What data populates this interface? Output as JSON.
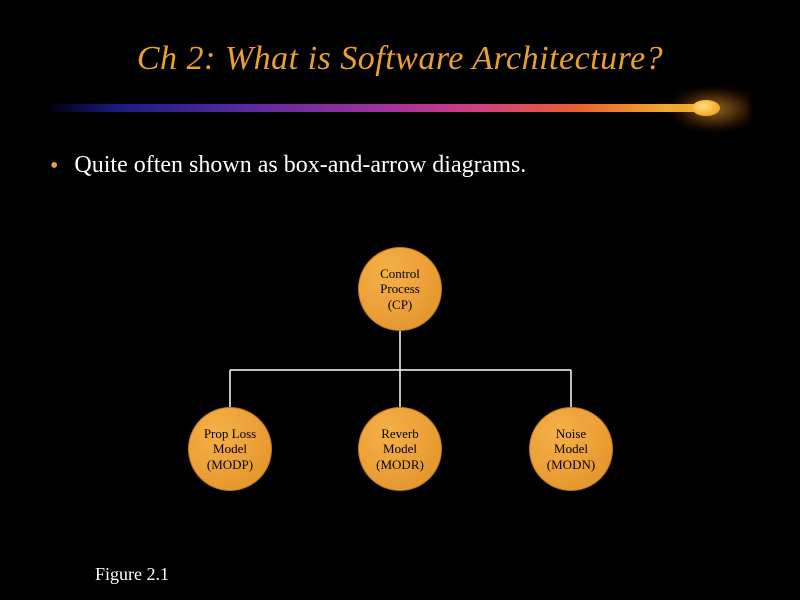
{
  "title": "Ch 2: What is Software Architecture?",
  "bullet": {
    "text": "Quite often shown as box-and-arrow diagrams."
  },
  "diagram": {
    "nodes": {
      "cp": {
        "line1": "Control",
        "line2": "Process",
        "line3": "(CP)"
      },
      "modp": {
        "line1": "Prop Loss",
        "line2": "Model",
        "line3": "(MODP)"
      },
      "modr": {
        "line1": "Reverb",
        "line2": "Model",
        "line3": "(MODR)"
      },
      "modn": {
        "line1": "Noise",
        "line2": "Model",
        "line3": "(MODN)"
      }
    }
  },
  "figure_label": "Figure 2.1",
  "colors": {
    "accent": "#e8a030",
    "node_fill": "#eca038",
    "bg": "#000000"
  }
}
